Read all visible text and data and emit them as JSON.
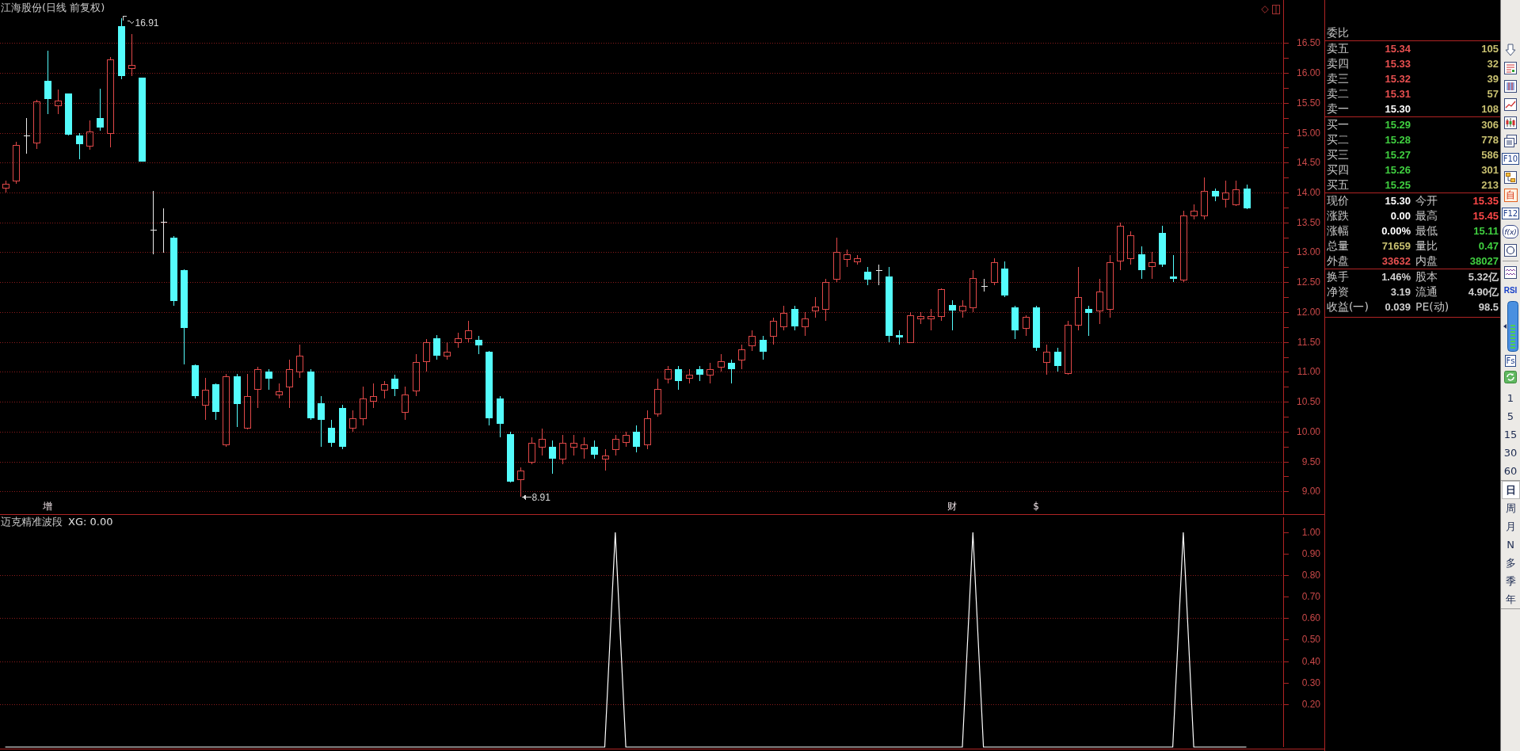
{
  "chart": {
    "title": "江海股份(日线 前复权)",
    "high_label": "16.91",
    "low_label": "8.91",
    "chart_data": {
      "type": "candlestick",
      "categories": [
        null,
        null,
        null,
        null,
        "增",
        null,
        null,
        null,
        null,
        null,
        null,
        null,
        null,
        null,
        null,
        null,
        null,
        null,
        null,
        null,
        null,
        null,
        null,
        null,
        null,
        null,
        null,
        null,
        null,
        null,
        null,
        null,
        null,
        null,
        null,
        null,
        null,
        null,
        null,
        null,
        null,
        null,
        null,
        null,
        null,
        null,
        null,
        null,
        null,
        null,
        null,
        null,
        null,
        null,
        null,
        null,
        null,
        null,
        null,
        null,
        null,
        null,
        null,
        null,
        null,
        null,
        null,
        null,
        null,
        null,
        null,
        null,
        null,
        null,
        null,
        null,
        null,
        null,
        null,
        null,
        null,
        null,
        null,
        null,
        null,
        null,
        null,
        null,
        null,
        null,
        "财",
        null,
        null,
        null,
        null,
        null,
        null,
        null,
        "$",
        null,
        null,
        null,
        null,
        null,
        null,
        null,
        null,
        null,
        null,
        null,
        null,
        null,
        null,
        null,
        null,
        null,
        null,
        null,
        null,
        null,
        null,
        null
      ],
      "ylim": [
        8.62,
        17.22
      ],
      "grid": true,
      "yticks": [
        {
          "value": 16.5,
          "label": "16.50"
        },
        {
          "value": 16,
          "label": "16.00"
        },
        {
          "value": 15.5,
          "label": "15.50"
        },
        {
          "value": 15,
          "label": "15.00"
        },
        {
          "value": 14.5,
          "label": "14.50"
        },
        {
          "value": 14,
          "label": "14.00"
        },
        {
          "value": 13.5,
          "label": "13.50"
        },
        {
          "value": 13,
          "label": "13.00"
        },
        {
          "value": 12.5,
          "label": "12.50"
        },
        {
          "value": 12,
          "label": "12.00"
        },
        {
          "value": 11.5,
          "label": "11.50"
        },
        {
          "value": 11,
          "label": "11.00"
        },
        {
          "value": 10.5,
          "label": "10.50"
        },
        {
          "value": 10,
          "label": "10.00"
        },
        {
          "value": 9.5,
          "label": "9.50"
        },
        {
          "value": 9,
          "label": "9.00"
        }
      ],
      "ohlc": [
        [
          14.08,
          14.2,
          14.0,
          14.15
        ],
        [
          14.2,
          14.85,
          14.15,
          14.8
        ],
        [
          14.95,
          15.25,
          14.65,
          14.95
        ],
        [
          14.84,
          15.55,
          14.73,
          15.53
        ],
        [
          15.87,
          16.37,
          15.31,
          15.57
        ],
        [
          15.46,
          15.72,
          15.31,
          15.54
        ],
        [
          15.66,
          15.66,
          14.95,
          14.97
        ],
        [
          14.96,
          15.0,
          14.55,
          14.81
        ],
        [
          14.78,
          15.2,
          14.72,
          15.02
        ],
        [
          15.25,
          15.74,
          15.04,
          15.09
        ],
        [
          14.99,
          16.27,
          14.76,
          16.22
        ],
        [
          16.78,
          16.91,
          15.9,
          15.95
        ],
        [
          16.08,
          16.65,
          15.95,
          16.13
        ],
        [
          15.92,
          15.92,
          14.52,
          14.52
        ],
        [
          13.38,
          14.03,
          12.96,
          13.38
        ],
        [
          13.51,
          13.74,
          12.99,
          13.51
        ],
        [
          13.25,
          13.27,
          12.1,
          12.18
        ],
        [
          12.7,
          12.72,
          11.13,
          11.73
        ],
        [
          11.11,
          11.12,
          10.55,
          10.59
        ],
        [
          10.45,
          10.9,
          10.2,
          10.7
        ],
        [
          10.79,
          10.8,
          10.2,
          10.33
        ],
        [
          9.78,
          10.97,
          9.75,
          10.92
        ],
        [
          10.92,
          10.97,
          10.08,
          10.46
        ],
        [
          10.07,
          10.97,
          10.04,
          10.59
        ],
        [
          10.72,
          11.08,
          10.4,
          11.05
        ],
        [
          11.0,
          11.05,
          10.7,
          10.88
        ],
        [
          10.62,
          10.8,
          10.55,
          10.68
        ],
        [
          10.75,
          11.2,
          10.4,
          11.05
        ],
        [
          11.01,
          11.45,
          10.9,
          11.27
        ],
        [
          11.01,
          11.05,
          10.2,
          10.23
        ],
        [
          10.48,
          10.6,
          9.75,
          10.2
        ],
        [
          10.07,
          10.2,
          9.75,
          9.81
        ],
        [
          10.4,
          10.45,
          9.7,
          9.75
        ],
        [
          10.07,
          10.35,
          10.0,
          10.23
        ],
        [
          10.23,
          10.75,
          10.1,
          10.56
        ],
        [
          10.52,
          10.8,
          10.4,
          10.59
        ],
        [
          10.7,
          10.85,
          10.55,
          10.79
        ],
        [
          10.88,
          10.95,
          10.6,
          10.72
        ],
        [
          10.33,
          10.75,
          10.2,
          10.62
        ],
        [
          10.69,
          11.3,
          10.6,
          11.16
        ],
        [
          11.18,
          11.55,
          11.0,
          11.5
        ],
        [
          11.56,
          11.62,
          11.2,
          11.27
        ],
        [
          11.27,
          11.5,
          11.2,
          11.33
        ],
        [
          11.5,
          11.65,
          11.4,
          11.56
        ],
        [
          11.56,
          11.85,
          11.5,
          11.7
        ],
        [
          11.53,
          11.6,
          11.3,
          11.44
        ],
        [
          11.33,
          11.35,
          10.1,
          10.23
        ],
        [
          10.56,
          10.6,
          9.9,
          10.13
        ],
        [
          9.96,
          10.0,
          9.15,
          9.16
        ],
        [
          9.2,
          9.4,
          8.91,
          9.35
        ],
        [
          9.5,
          9.9,
          9.45,
          9.81
        ],
        [
          9.75,
          10.05,
          9.6,
          9.88
        ],
        [
          9.75,
          9.85,
          9.3,
          9.55
        ],
        [
          9.55,
          9.95,
          9.45,
          9.81
        ],
        [
          9.75,
          9.95,
          9.6,
          9.81
        ],
        [
          9.72,
          9.9,
          9.55,
          9.78
        ],
        [
          9.75,
          9.85,
          9.55,
          9.62
        ],
        [
          9.55,
          9.7,
          9.35,
          9.6
        ],
        [
          9.7,
          9.95,
          9.6,
          9.88
        ],
        [
          9.82,
          10.0,
          9.75,
          9.94
        ],
        [
          10.0,
          10.1,
          9.65,
          9.75
        ],
        [
          9.78,
          10.35,
          9.7,
          10.23
        ],
        [
          10.3,
          10.88,
          10.25,
          10.72
        ],
        [
          10.88,
          11.1,
          10.8,
          11.05
        ],
        [
          11.05,
          11.1,
          10.7,
          10.85
        ],
        [
          10.9,
          11.05,
          10.8,
          10.95
        ],
        [
          11.05,
          11.1,
          10.85,
          10.95
        ],
        [
          10.95,
          11.15,
          10.8,
          11.05
        ],
        [
          11.08,
          11.3,
          11.0,
          11.18
        ],
        [
          11.15,
          11.2,
          10.8,
          11.05
        ],
        [
          11.2,
          11.45,
          11.05,
          11.37
        ],
        [
          11.44,
          11.7,
          11.35,
          11.6
        ],
        [
          11.53,
          11.6,
          11.2,
          11.33
        ],
        [
          11.6,
          11.9,
          11.45,
          11.85
        ],
        [
          11.76,
          12.1,
          11.7,
          11.99
        ],
        [
          12.05,
          12.1,
          11.7,
          11.76
        ],
        [
          11.76,
          12.0,
          11.6,
          11.89
        ],
        [
          12.02,
          12.25,
          11.9,
          12.09
        ],
        [
          12.05,
          12.55,
          11.85,
          12.5
        ],
        [
          12.55,
          13.25,
          12.5,
          13.0
        ],
        [
          12.89,
          13.05,
          12.75,
          12.96
        ],
        [
          12.85,
          12.95,
          12.8,
          12.9
        ],
        [
          12.67,
          12.75,
          12.45,
          12.54
        ],
        [
          12.7,
          12.8,
          12.45,
          12.7
        ],
        [
          12.6,
          12.75,
          11.5,
          11.6
        ],
        [
          11.62,
          11.7,
          11.45,
          11.57
        ],
        [
          11.5,
          12.0,
          11.5,
          11.95
        ],
        [
          11.89,
          12.0,
          11.8,
          11.93
        ],
        [
          11.89,
          12.05,
          11.7,
          11.93
        ],
        [
          11.93,
          12.4,
          11.85,
          12.38
        ],
        [
          12.12,
          12.2,
          11.7,
          12.02
        ],
        [
          12.02,
          12.2,
          11.9,
          12.1
        ],
        [
          12.08,
          12.7,
          12.0,
          12.57
        ],
        [
          12.44,
          12.55,
          12.35,
          12.44
        ],
        [
          12.5,
          12.9,
          12.45,
          12.83
        ],
        [
          12.73,
          12.85,
          12.25,
          12.28
        ],
        [
          12.08,
          12.1,
          11.55,
          11.7
        ],
        [
          11.73,
          11.95,
          11.6,
          11.92
        ],
        [
          12.08,
          12.1,
          11.35,
          11.4
        ],
        [
          11.17,
          11.45,
          10.95,
          11.33
        ],
        [
          11.33,
          11.4,
          11.0,
          11.1
        ],
        [
          10.98,
          11.85,
          10.95,
          11.79
        ],
        [
          11.79,
          12.75,
          11.7,
          12.25
        ],
        [
          12.05,
          12.1,
          11.6,
          11.99
        ],
        [
          12.02,
          12.55,
          11.8,
          12.35
        ],
        [
          12.05,
          12.95,
          11.9,
          12.83
        ],
        [
          12.86,
          13.5,
          12.7,
          13.45
        ],
        [
          12.9,
          13.35,
          12.8,
          13.28
        ],
        [
          12.96,
          13.1,
          12.55,
          12.7
        ],
        [
          12.77,
          13.0,
          12.55,
          12.83
        ],
        [
          13.32,
          13.45,
          12.75,
          12.8
        ],
        [
          12.6,
          12.95,
          12.5,
          12.55
        ],
        [
          12.54,
          13.7,
          12.5,
          13.61
        ],
        [
          13.61,
          13.8,
          13.55,
          13.7
        ],
        [
          13.62,
          14.25,
          13.55,
          14.03
        ],
        [
          14.03,
          14.07,
          13.85,
          13.93
        ],
        [
          13.9,
          14.2,
          13.75,
          14.0
        ],
        [
          13.8,
          14.2,
          13.78,
          14.05
        ],
        [
          14.07,
          14.13,
          13.72,
          13.74
        ],
        null,
        null,
        null
      ]
    }
  },
  "indicator": {
    "name": "迈克精准波段",
    "reading": "XG: 0.00",
    "chart_data": {
      "type": "line",
      "categories": [
        null,
        null,
        null,
        null,
        null,
        null,
        null,
        null,
        null,
        null,
        null,
        null,
        null,
        null,
        null,
        null,
        null,
        null,
        null,
        null,
        null,
        null,
        null,
        null,
        null,
        null,
        null,
        null,
        null,
        null,
        null,
        null,
        null,
        null,
        null,
        null,
        null,
        null,
        null,
        null,
        null,
        null,
        null,
        null,
        null,
        null,
        null,
        null,
        null,
        null,
        null,
        null,
        null,
        null,
        null,
        null,
        null,
        null,
        null,
        null,
        null,
        null,
        null,
        null,
        null,
        null,
        null,
        null,
        null,
        null,
        null,
        null,
        null,
        null,
        null,
        null,
        null,
        null,
        null,
        null,
        null,
        null,
        null,
        null,
        null,
        null,
        null,
        null,
        null,
        null,
        null,
        null,
        null,
        null,
        null,
        null,
        null,
        null,
        null,
        null,
        null,
        null,
        null,
        null,
        null,
        null,
        null,
        null,
        null,
        null,
        null,
        null,
        null,
        null,
        null,
        null,
        null,
        null,
        null,
        null,
        null,
        null
      ],
      "ylim": [
        0,
        1.07
      ],
      "grid": true,
      "yticks": [
        {
          "value": 1,
          "label": "1.00"
        },
        {
          "value": 0.9,
          "label": "0.90"
        },
        {
          "value": 0.8,
          "label": "0.80"
        },
        {
          "value": 0.7,
          "label": "0.70"
        },
        {
          "value": 0.6,
          "label": "0.60"
        },
        {
          "value": 0.5,
          "label": "0.50"
        },
        {
          "value": 0.4,
          "label": "0.40"
        },
        {
          "value": 0.3,
          "label": "0.30"
        },
        {
          "value": 0.2,
          "label": "0.20"
        }
      ],
      "series": [
        {
          "color": "#ffffff",
          "values": [
            0,
            0,
            0,
            0,
            0,
            0,
            0,
            0,
            0,
            0,
            0,
            0,
            0,
            0,
            0,
            0,
            0,
            0,
            0,
            0,
            0,
            0,
            0,
            0,
            0,
            0,
            0,
            0,
            0,
            0,
            0,
            0,
            0,
            0,
            0,
            0,
            0,
            0,
            0,
            0,
            0,
            0,
            0,
            0,
            0,
            0,
            0,
            0,
            0,
            0,
            0,
            0,
            0,
            0,
            0,
            0,
            0,
            0,
            1,
            0,
            0,
            0,
            0,
            0,
            0,
            0,
            0,
            0,
            0,
            0,
            0,
            0,
            0,
            0,
            0,
            0,
            0,
            0,
            0,
            0,
            0,
            0,
            0,
            0,
            0,
            0,
            0,
            0,
            0,
            0,
            0,
            0,
            1,
            0,
            0,
            0,
            0,
            0,
            0,
            0,
            0,
            0,
            0,
            0,
            0,
            0,
            0,
            0,
            0,
            0,
            0,
            0,
            1,
            0,
            0,
            0,
            0,
            0,
            0,
            null,
            null,
            null
          ]
        }
      ]
    }
  },
  "quote": {
    "ratio_label": "委比",
    "asks": [
      {
        "label": "卖五",
        "price": "15.34",
        "volume": "105",
        "color": "#e85050"
      },
      {
        "label": "卖四",
        "price": "15.33",
        "volume": "32",
        "color": "#e85050"
      },
      {
        "label": "卖三",
        "price": "15.32",
        "volume": "39",
        "color": "#e85050"
      },
      {
        "label": "卖二",
        "price": "15.31",
        "volume": "57",
        "color": "#e85050"
      },
      {
        "label": "卖一",
        "price": "15.30",
        "volume": "108",
        "color": "#ffffff"
      }
    ],
    "bids": [
      {
        "label": "买一",
        "price": "15.29",
        "volume": "306",
        "color": "#40d040"
      },
      {
        "label": "买二",
        "price": "15.28",
        "volume": "778",
        "color": "#40d040"
      },
      {
        "label": "买三",
        "price": "15.27",
        "volume": "586",
        "color": "#40d040"
      },
      {
        "label": "买四",
        "price": "15.26",
        "volume": "301",
        "color": "#40d040"
      },
      {
        "label": "买五",
        "price": "15.25",
        "volume": "213",
        "color": "#40d040"
      }
    ],
    "stats": [
      {
        "left": {
          "label": "现价",
          "value": "15.30",
          "color": "#ffffff"
        },
        "right": {
          "label": "今开",
          "value": "15.35",
          "color": "#ff4848"
        }
      },
      {
        "left": {
          "label": "涨跌",
          "value": "0.00",
          "color": "#ffffff"
        },
        "right": {
          "label": "最高",
          "value": "15.45",
          "color": "#ff4848"
        }
      },
      {
        "left": {
          "label": "涨幅",
          "value": "0.00%",
          "color": "#ffffff"
        },
        "right": {
          "label": "最低",
          "value": "15.11",
          "color": "#40d040"
        }
      },
      {
        "left": {
          "label": "总量",
          "value": "71659",
          "color": "#c8c070"
        },
        "right": {
          "label": "量比",
          "value": "0.47",
          "color": "#40d040"
        }
      },
      {
        "left": {
          "label": "外盘",
          "value": "33632",
          "color": "#e85050"
        },
        "right": {
          "label": "内盘",
          "value": "38027",
          "color": "#40d040"
        }
      }
    ],
    "fundamentals": [
      {
        "left": {
          "label": "换手",
          "value": "1.46%"
        },
        "right": {
          "label": "股本",
          "value": "5.32亿"
        }
      },
      {
        "left": {
          "label": "净资",
          "value": "3.19"
        },
        "right": {
          "label": "流通",
          "value": "4.90亿"
        }
      },
      {
        "left": {
          "label": "收益(一)",
          "value": "0.039"
        },
        "right": {
          "label": "PE(动)",
          "value": "98.5"
        }
      }
    ]
  },
  "toolbar": {
    "tools": [
      {
        "kind": "arrow"
      },
      {
        "kind": "table"
      },
      {
        "kind": "grid"
      },
      {
        "kind": "line"
      },
      {
        "kind": "candle"
      },
      {
        "kind": "doc"
      },
      {
        "kind": "boxed",
        "text": "F10"
      },
      {
        "kind": "tree"
      },
      {
        "kind": "tile",
        "text": "自"
      },
      {
        "kind": "boxed",
        "text": "F12"
      },
      {
        "kind": "round",
        "text": "f(x)"
      },
      {
        "kind": "circle"
      },
      {
        "kind": "rule"
      },
      {
        "kind": "wave"
      },
      {
        "kind": "plain",
        "text": "RSI"
      },
      {
        "kind": "gauge"
      },
      {
        "kind": "boxed",
        "text": "Fs"
      },
      {
        "kind": "refresh"
      }
    ],
    "period_groups": [
      [
        {
          "label": "1",
          "selected": false
        },
        {
          "label": "5",
          "selected": false
        },
        {
          "label": "15",
          "selected": false
        },
        {
          "label": "30",
          "selected": false
        },
        {
          "label": "60",
          "selected": false
        }
      ],
      [
        {
          "label": "日",
          "selected": true
        },
        {
          "label": "周",
          "selected": false
        },
        {
          "label": "月",
          "selected": false
        },
        {
          "label": "N",
          "selected": false
        },
        {
          "label": "多",
          "selected": false
        },
        {
          "label": "季",
          "selected": false
        },
        {
          "label": "年",
          "selected": false
        }
      ]
    ]
  }
}
